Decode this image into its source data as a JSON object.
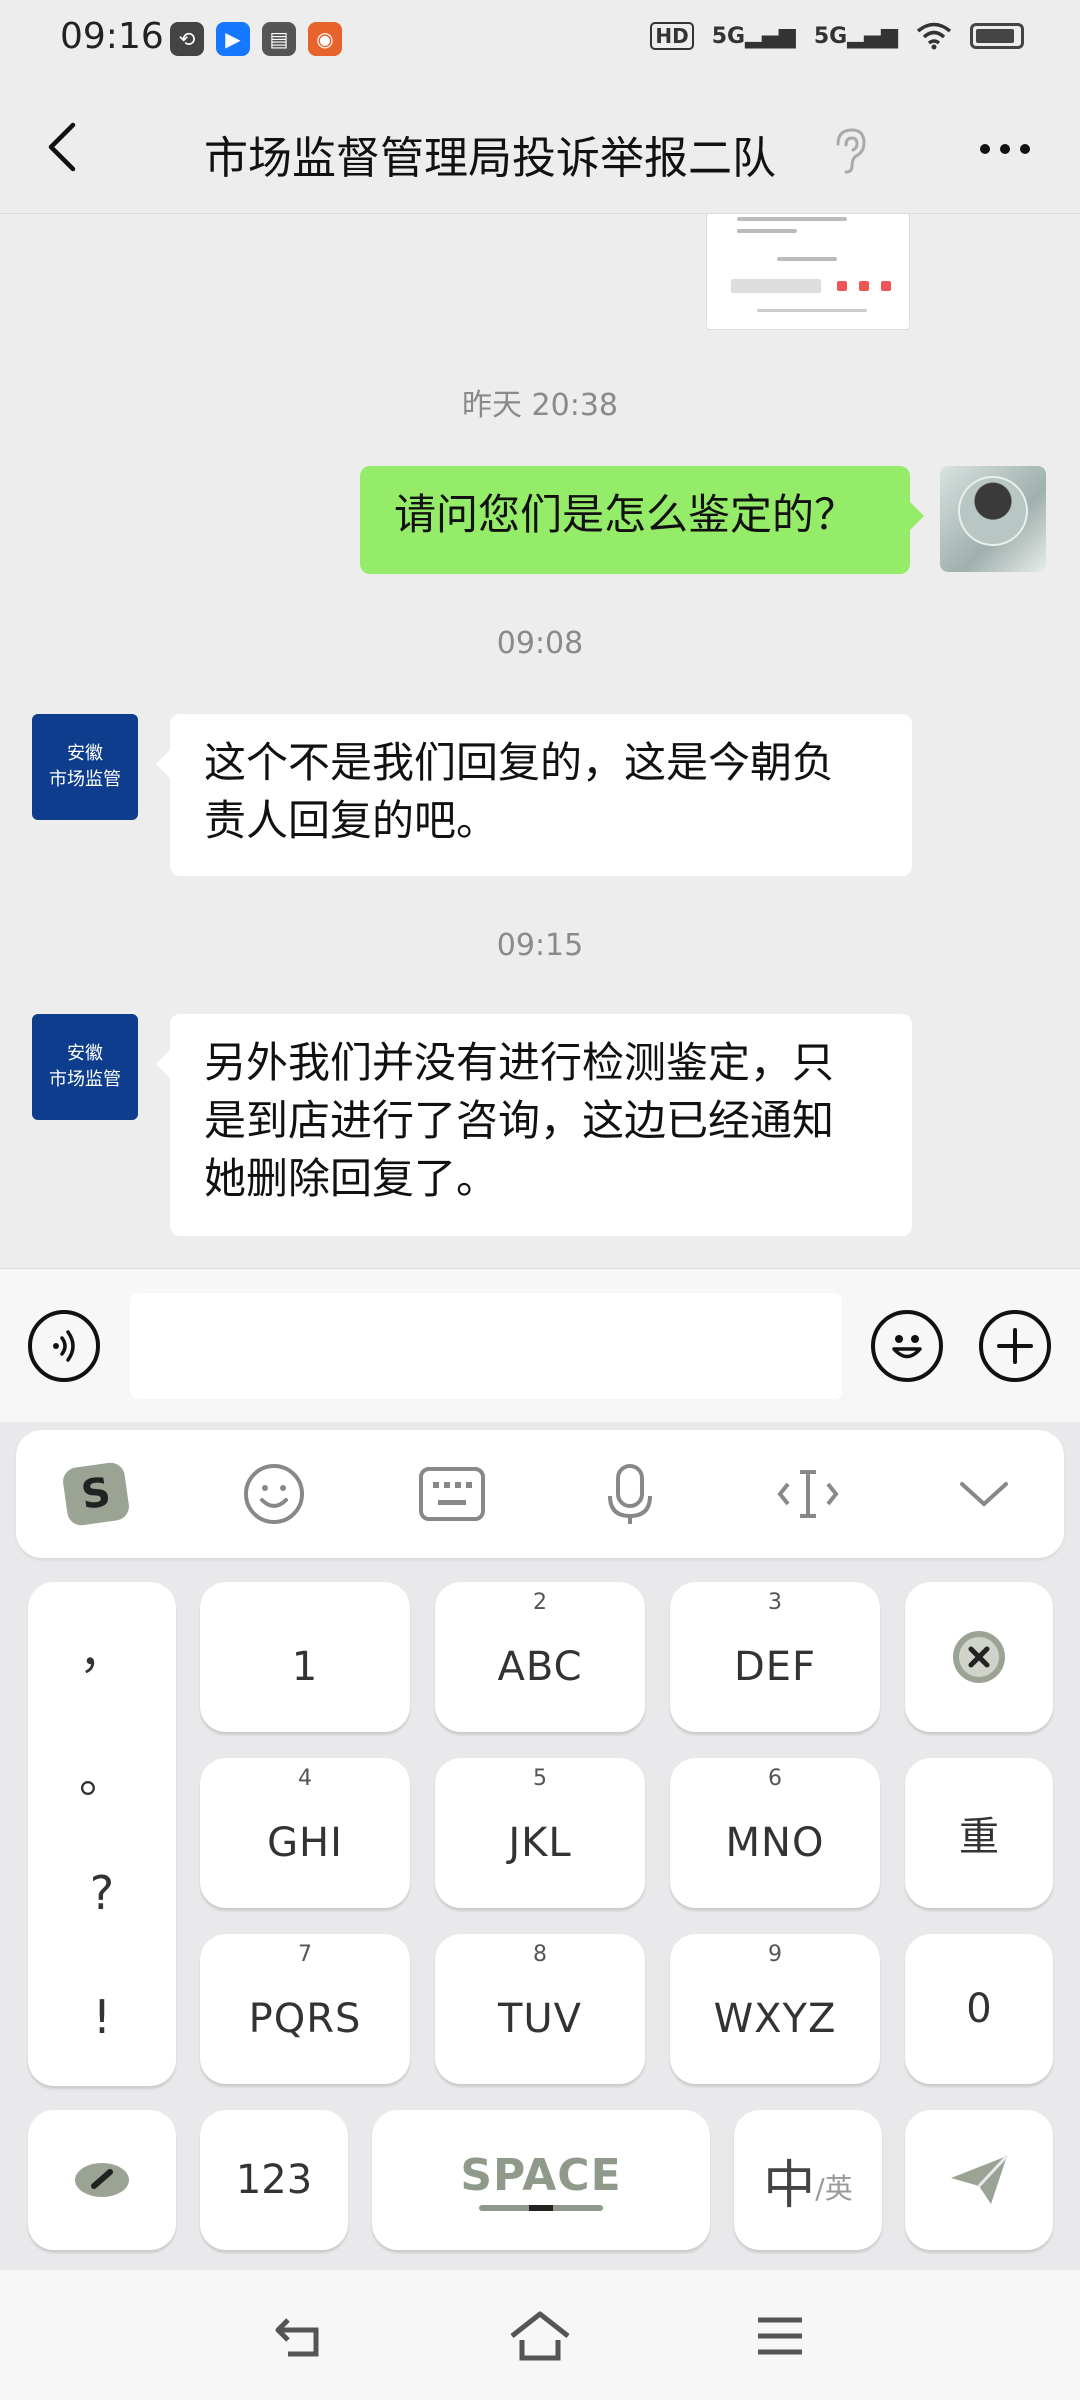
{
  "status_bar": {
    "time": "09:16",
    "network_1": "5G",
    "network_2": "5G",
    "hd_label": "HD"
  },
  "header": {
    "title": "市场监督管理局投诉举报二队"
  },
  "messages": [
    {
      "type": "timestamp",
      "text": "昨天 20:38"
    },
    {
      "type": "sent",
      "text": "请问您们是怎么鉴定的？"
    },
    {
      "type": "timestamp",
      "text": "09:08"
    },
    {
      "type": "received",
      "lines": [
        "这个不是我们回复的，这是今朝负",
        "责人回复的吧。"
      ]
    },
    {
      "type": "timestamp",
      "text": "09:15"
    },
    {
      "type": "received",
      "lines": [
        "另外我们并没有进行检测鉴定，只",
        "是到店进行了咨询，这边已经通知",
        "她删除回复了。"
      ]
    }
  ],
  "org_avatar": {
    "line1": "安徽",
    "line2": "市场监管"
  },
  "input": {
    "value": ""
  },
  "keyboard": {
    "punctuation": [
      "，",
      "。",
      "?",
      "!"
    ],
    "keys": {
      "k1": {
        "num": "",
        "label": "1"
      },
      "k2": {
        "num": "2",
        "label": "ABC"
      },
      "k3": {
        "num": "3",
        "label": "DEF"
      },
      "k4": {
        "num": "4",
        "label": "GHI"
      },
      "k5": {
        "num": "5",
        "label": "JKL"
      },
      "k6": {
        "num": "6",
        "label": "MNO"
      },
      "k7": {
        "num": "7",
        "label": "PQRS"
      },
      "k8": {
        "num": "8",
        "label": "TUV"
      },
      "k9": {
        "num": "9",
        "label": "WXYZ"
      },
      "k0": {
        "label": "0"
      },
      "redo": {
        "label": "重"
      },
      "num123": {
        "label": "123"
      },
      "space": {
        "label": "SPACE"
      },
      "lang_main": "中",
      "lang_sub": "/英"
    }
  },
  "colors": {
    "sent_bubble": "#95ec69",
    "received_bubble": "#ffffff",
    "org_avatar": "#0d3d8c",
    "background": "#ededed"
  }
}
